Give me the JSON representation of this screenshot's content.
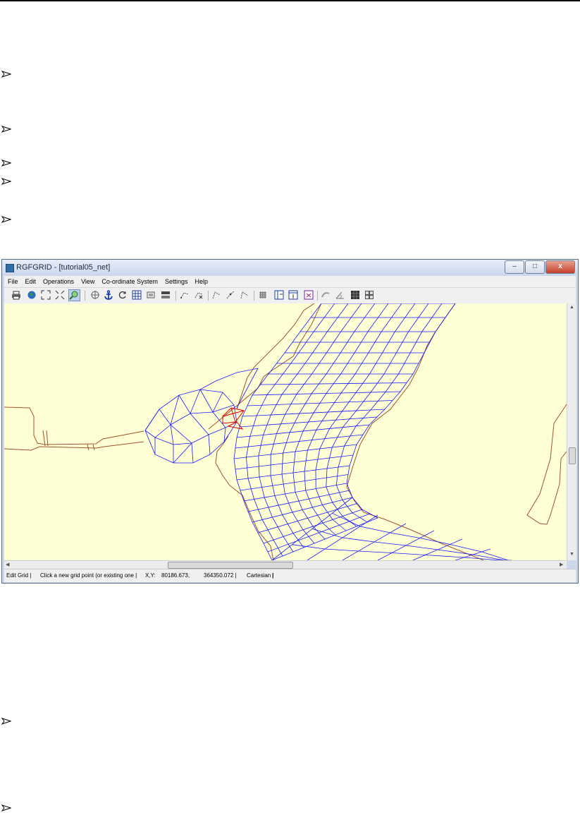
{
  "window": {
    "title": "RGFGRID - [tutorial05_net]",
    "controls": {
      "minimize": "–",
      "maximize": "□",
      "close": "x"
    }
  },
  "menu": [
    {
      "label": "File"
    },
    {
      "label": "Edit"
    },
    {
      "label": "Operations"
    },
    {
      "label": "View"
    },
    {
      "label": "Co-ordinate System"
    },
    {
      "label": "Settings"
    },
    {
      "label": "Help"
    }
  ],
  "toolbar": {
    "buttons": [
      "print-icon",
      "globe-icon",
      "zoom-extent-icon",
      "zoom-fit-icon",
      "zoom-box-icon",
      "crosshair-icon",
      "anchor-icon",
      "refresh-icon",
      "grid-refine-icon",
      "properties-icon",
      "land-boundary-icon",
      "spline-icon",
      "delete-spline-icon",
      "spline-point-icon",
      "spline-insert-icon",
      "spline-move-icon",
      "grid-icon",
      "grid-insert-icon",
      "grid-add-icon",
      "grid-delete-icon",
      "curve-icon",
      "orthogonality-icon",
      "block-fill-icon",
      "window-grid-icon"
    ],
    "pressed": "zoom-box-icon"
  },
  "status": {
    "mode": "Edit Grid |",
    "hint": "Click a new grid point (or existing one |",
    "coord_label": "X,Y:",
    "x_value": "80186.673,",
    "y_value": "364350.072 |",
    "system": "Cartesian |",
    "tail": "|"
  },
  "colors": {
    "canvas_bg": "#ffffd6",
    "grid_lines": "#1a1aff",
    "land_boundary": "#a0522d",
    "selection": "#e00000"
  }
}
